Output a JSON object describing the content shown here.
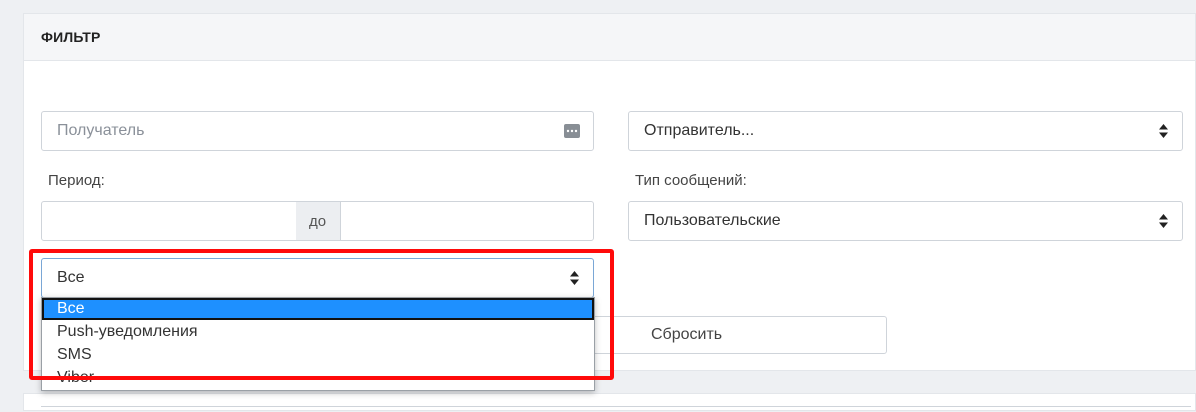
{
  "filter": {
    "title": "ФИЛЬТР",
    "recipient": {
      "placeholder": "Получатель",
      "icon": "contact-card-icon"
    },
    "sender": {
      "value": "Отправитель...",
      "icon": "sort-arrows-icon"
    },
    "period": {
      "label": "Период:",
      "to_label": "до",
      "from_value": "",
      "to_value": ""
    },
    "message_type": {
      "label": "Тип сообщений:",
      "value": "Пользовательские",
      "icon": "sort-arrows-icon"
    },
    "channel": {
      "value": "Все",
      "icon": "sort-arrows-icon",
      "options": [
        "Все",
        "Push-уведомления",
        "SMS",
        "Viber"
      ],
      "selected_index": 0
    },
    "reset_button": "Сбросить"
  },
  "colors": {
    "highlight_border": "#ff0a0a",
    "selected_option_bg": "#1e90ff"
  }
}
